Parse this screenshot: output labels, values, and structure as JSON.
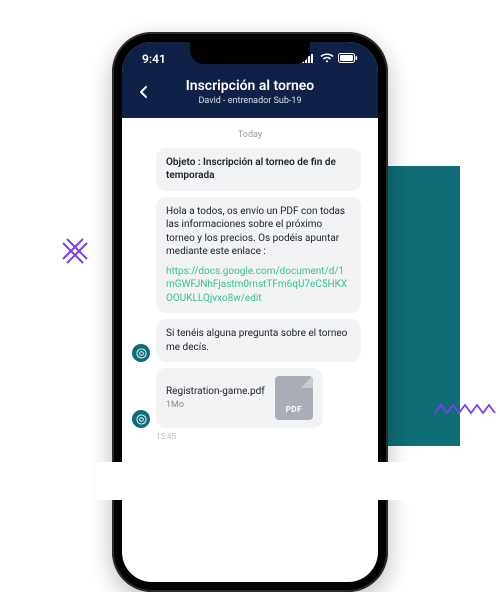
{
  "status": {
    "time": "9:41"
  },
  "header": {
    "title": "Inscripción al torneo",
    "subtitle": "David - entrenador Sub-19"
  },
  "chat": {
    "date": "Today",
    "subject": "Objeto : Inscripción al torneo de fin de temporada",
    "body": "Hola a todos, os envío un PDF con todas las informaciones sobre el próximo torneo y los precios. Os podéis apuntar mediante este enlace :",
    "link": "https://docs.google.com/document/d/1mGWFJNhFjastm0rnstTFm6qU7eC5HKXOOUKLLQjvxo8w/edit",
    "followup": "Si tenéis alguna pregunta sobre el torneo me decís.",
    "file": {
      "name": "Registration-game.pdf",
      "size": "1Mo",
      "badge": "PDF"
    },
    "time": "15:45"
  }
}
